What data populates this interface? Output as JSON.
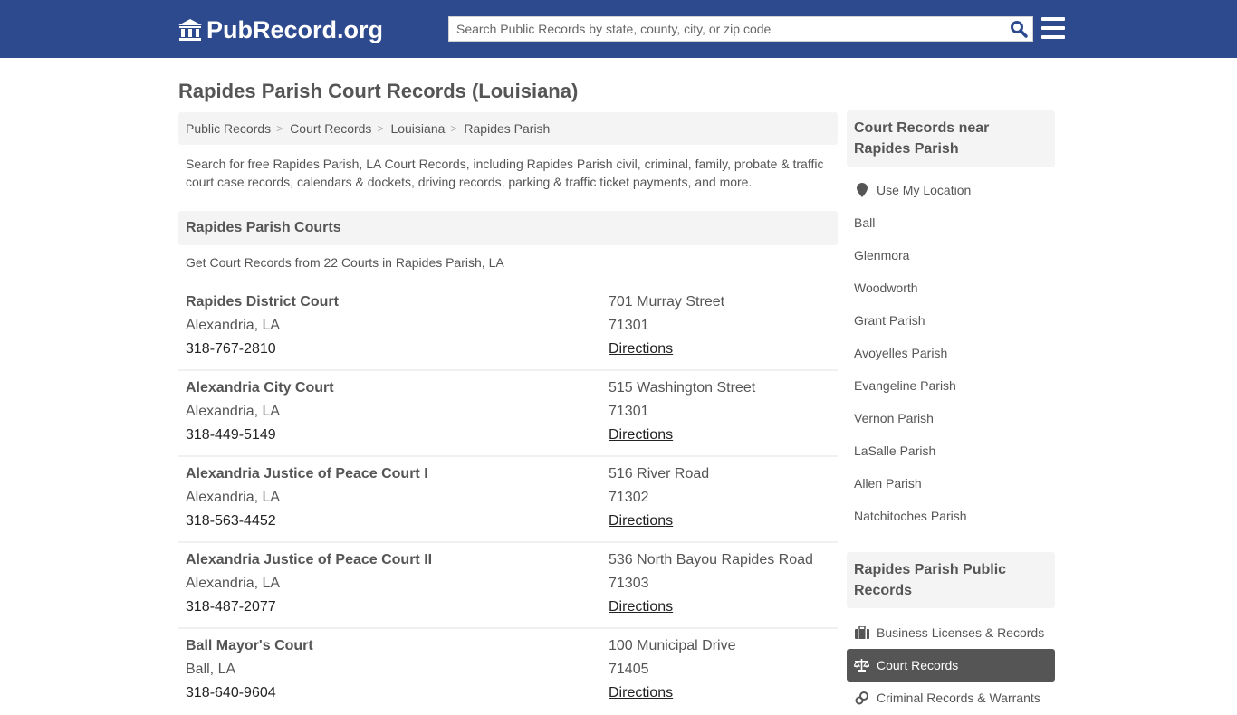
{
  "header": {
    "logo_text": "PubRecord.org",
    "search_placeholder": "Search Public Records by state, county, city, or zip code",
    "brand_color": "#2e4a8f",
    "search_icon_color": "#2e4a8f"
  },
  "page": {
    "title": "Rapides Parish Court Records (Louisiana)"
  },
  "breadcrumb": [
    {
      "label": "Public Records"
    },
    {
      "label": "Court Records"
    },
    {
      "label": "Louisiana"
    },
    {
      "label": "Rapides Parish"
    }
  ],
  "intro": "Search for free Rapides Parish, LA Court Records, including Rapides Parish civil, criminal, family, probate & traffic court case records, calendars & dockets, driving records, parking & traffic ticket payments, and more.",
  "courts_section": {
    "heading": "Rapides Parish Courts",
    "subtext": "Get Court Records from 22 Courts in Rapides Parish, LA",
    "items": [
      {
        "name": "Rapides District Court",
        "city": "Alexandria, LA",
        "phone": "318-767-2810",
        "address": "701 Murray Street",
        "zip": "71301",
        "directions": "Directions"
      },
      {
        "name": "Alexandria City Court",
        "city": "Alexandria, LA",
        "phone": "318-449-5149",
        "address": "515 Washington Street",
        "zip": "71301",
        "directions": "Directions"
      },
      {
        "name": "Alexandria Justice of Peace Court I",
        "city": "Alexandria, LA",
        "phone": "318-563-4452",
        "address": "516 River Road",
        "zip": "71302",
        "directions": "Directions"
      },
      {
        "name": "Alexandria Justice of Peace Court II",
        "city": "Alexandria, LA",
        "phone": "318-487-2077",
        "address": "536 North Bayou Rapides Road",
        "zip": "71303",
        "directions": "Directions"
      },
      {
        "name": "Ball Mayor's Court",
        "city": "Ball, LA",
        "phone": "318-640-9604",
        "address": "100 Municipal Drive",
        "zip": "71405",
        "directions": "Directions"
      }
    ]
  },
  "sidebar": {
    "nearby_heading": "Court Records near Rapides Parish",
    "use_location": "Use My Location",
    "nearby": [
      "Ball",
      "Glenmora",
      "Woodworth",
      "Grant Parish",
      "Avoyelles Parish",
      "Evangeline Parish",
      "Vernon Parish",
      "LaSalle Parish",
      "Allen Parish",
      "Natchitoches Parish"
    ],
    "public_heading": "Rapides Parish Public Records",
    "public_records": [
      {
        "label": "Business Licenses & Records",
        "icon": "briefcase-icon",
        "active": false
      },
      {
        "label": "Court Records",
        "icon": "scales-icon",
        "active": true
      },
      {
        "label": "Criminal Records & Warrants",
        "icon": "handcuffs-icon",
        "active": false
      }
    ]
  }
}
